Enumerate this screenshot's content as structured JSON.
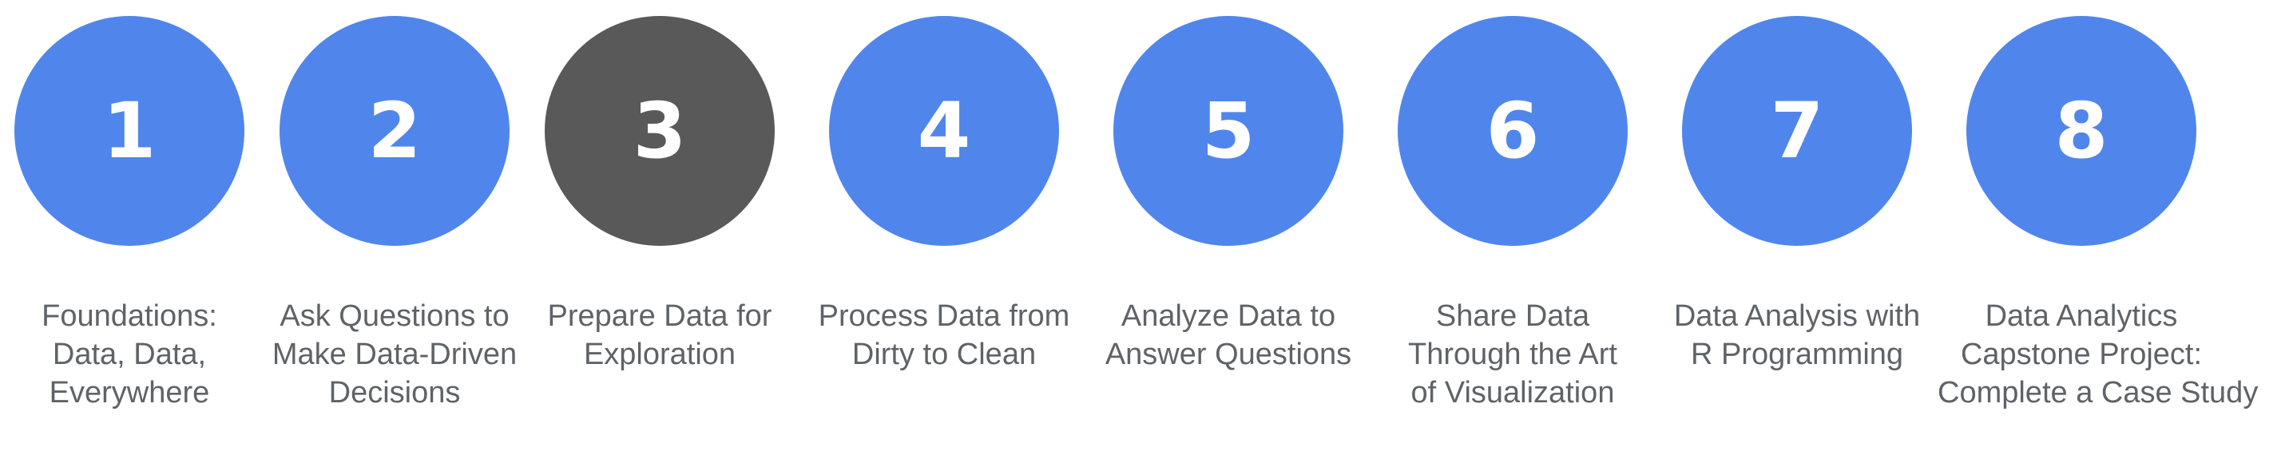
{
  "colors": {
    "step_circle": "#5086EC",
    "active_circle": "#595959",
    "number_text": "#FFFFFF",
    "label_text": "#5F6368"
  },
  "steps": [
    {
      "number": "1",
      "active": false,
      "label_lines": [
        "Foundations:",
        "Data, Data,",
        "Everywhere"
      ]
    },
    {
      "number": "2",
      "active": false,
      "label_lines": [
        "Ask Questions to",
        "Make Data-Driven",
        "Decisions"
      ]
    },
    {
      "number": "3",
      "active": true,
      "label_lines": [
        "Prepare Data for",
        "Exploration"
      ]
    },
    {
      "number": "4",
      "active": false,
      "label_lines": [
        "Process Data from",
        "Dirty to Clean"
      ]
    },
    {
      "number": "5",
      "active": false,
      "label_lines": [
        "Analyze Data to",
        "Answer Questions"
      ]
    },
    {
      "number": "6",
      "active": false,
      "label_lines": [
        "Share Data",
        "Through the Art",
        "of Visualization"
      ]
    },
    {
      "number": "7",
      "active": false,
      "label_lines": [
        "Data Analysis with",
        "R Programming"
      ]
    },
    {
      "number": "8",
      "active": false,
      "label_lines": [
        "Data Analytics",
        "Capstone Project:",
        "Complete a Case Study"
      ]
    }
  ]
}
